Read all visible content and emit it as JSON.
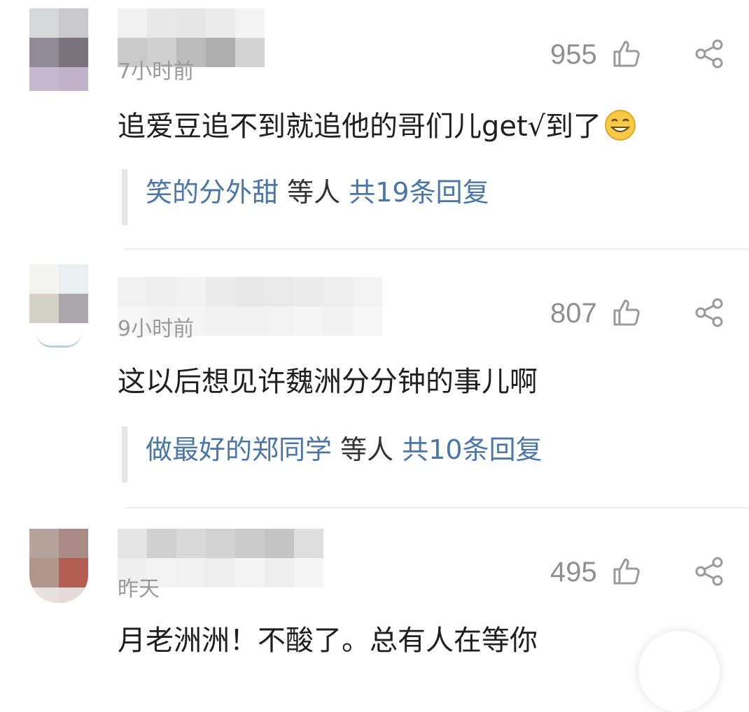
{
  "comments": [
    {
      "time": "7小时前",
      "likes": "955",
      "text": "追爱豆追不到就追他的哥们儿get√到了",
      "emoji": "smirk-grin-emoji",
      "reply_names": "笑的分外甜",
      "reply_others": "等人",
      "reply_total": "共19条回复"
    },
    {
      "time": "9小时前",
      "likes": "807",
      "text": "这以后想见许魏洲分分钟的事儿啊",
      "reply_names": "做最好的郑同学",
      "reply_others": "等人",
      "reply_total": "共10条回复"
    },
    {
      "time": "昨天",
      "likes": "495",
      "text": "月老洲洲！不酸了。总有人在等你"
    }
  ],
  "colors": {
    "link_blue": "#4a76a8",
    "meta_gray": "#9a9a9a",
    "divider": "#eeeeee"
  }
}
